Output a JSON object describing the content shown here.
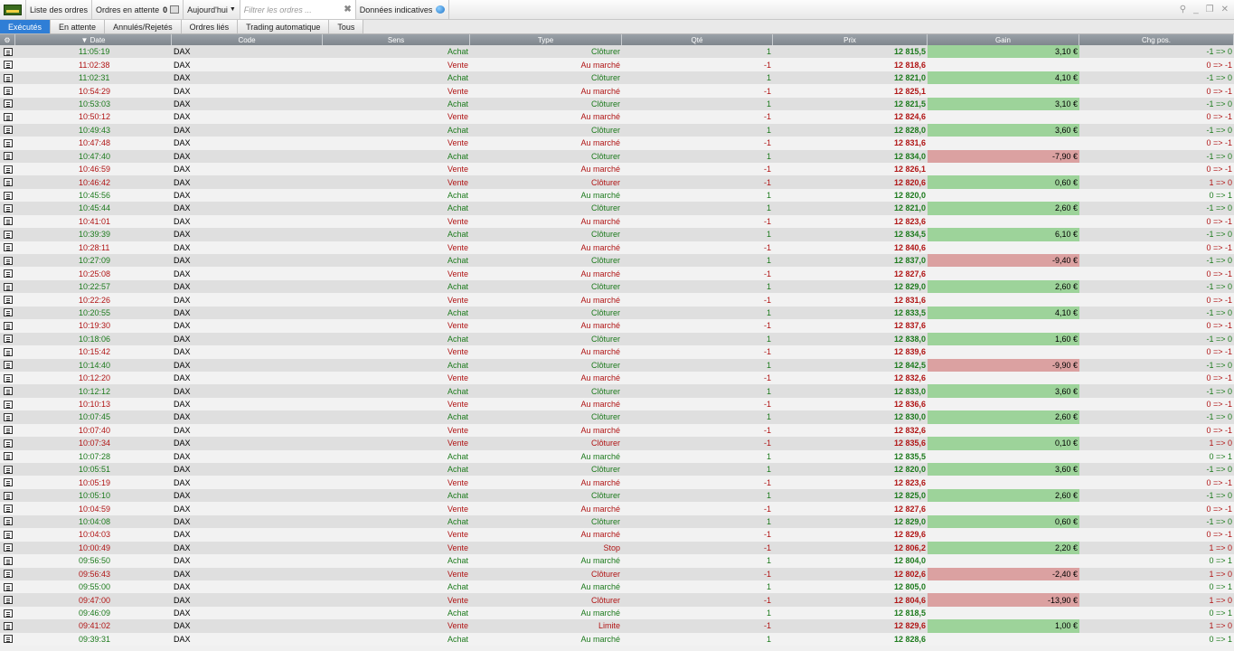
{
  "toolbar": {
    "orders_list": "Liste des ordres",
    "pending_label": "Ordres en attente",
    "pending_count": "0",
    "date_filter": "Aujourd'hui",
    "filter_placeholder": "Filtrer les ordres ...",
    "indicative": "Données indicatives"
  },
  "tabs": [
    "Exécutés",
    "En attente",
    "Annulés/Rejetés",
    "Ordres liés",
    "Trading automatique",
    "Tous"
  ],
  "columns": [
    "Date",
    "Code",
    "Sens",
    "Type",
    "Qté",
    "Prix",
    "Gain",
    "Chg pos."
  ],
  "colors": {
    "buy": "#1c7a1c",
    "sell": "#b01414",
    "gain_positive_bg": "#9dd39a",
    "gain_negative_bg": "#dba1a1",
    "active_tab": "#2f7ed6"
  },
  "rows": [
    {
      "date": "11:05:19",
      "code": "DAX",
      "sens": "Achat",
      "type": "Clôturer",
      "qty": "1",
      "price": "12 815,5",
      "gain": "3,10 €",
      "gain_sign": "pos",
      "chg": "-1 => 0"
    },
    {
      "date": "11:02:38",
      "code": "DAX",
      "sens": "Vente",
      "type": "Au marché",
      "qty": "-1",
      "price": "12 818,6",
      "gain": "",
      "gain_sign": "",
      "chg": "0 => -1"
    },
    {
      "date": "11:02:31",
      "code": "DAX",
      "sens": "Achat",
      "type": "Clôturer",
      "qty": "1",
      "price": "12 821,0",
      "gain": "4,10 €",
      "gain_sign": "pos",
      "chg": "-1 => 0"
    },
    {
      "date": "10:54:29",
      "code": "DAX",
      "sens": "Vente",
      "type": "Au marché",
      "qty": "-1",
      "price": "12 825,1",
      "gain": "",
      "gain_sign": "",
      "chg": "0 => -1"
    },
    {
      "date": "10:53:03",
      "code": "DAX",
      "sens": "Achat",
      "type": "Clôturer",
      "qty": "1",
      "price": "12 821,5",
      "gain": "3,10 €",
      "gain_sign": "pos",
      "chg": "-1 => 0"
    },
    {
      "date": "10:50:12",
      "code": "DAX",
      "sens": "Vente",
      "type": "Au marché",
      "qty": "-1",
      "price": "12 824,6",
      "gain": "",
      "gain_sign": "",
      "chg": "0 => -1"
    },
    {
      "date": "10:49:43",
      "code": "DAX",
      "sens": "Achat",
      "type": "Clôturer",
      "qty": "1",
      "price": "12 828,0",
      "gain": "3,60 €",
      "gain_sign": "pos",
      "chg": "-1 => 0"
    },
    {
      "date": "10:47:48",
      "code": "DAX",
      "sens": "Vente",
      "type": "Au marché",
      "qty": "-1",
      "price": "12 831,6",
      "gain": "",
      "gain_sign": "",
      "chg": "0 => -1"
    },
    {
      "date": "10:47:40",
      "code": "DAX",
      "sens": "Achat",
      "type": "Clôturer",
      "qty": "1",
      "price": "12 834,0",
      "gain": "-7,90 €",
      "gain_sign": "neg",
      "chg": "-1 => 0"
    },
    {
      "date": "10:46:59",
      "code": "DAX",
      "sens": "Vente",
      "type": "Au marché",
      "qty": "-1",
      "price": "12 826,1",
      "gain": "",
      "gain_sign": "",
      "chg": "0 => -1"
    },
    {
      "date": "10:46:42",
      "code": "DAX",
      "sens": "Vente",
      "type": "Clôturer",
      "qty": "-1",
      "price": "12 820,6",
      "gain": "0,60 €",
      "gain_sign": "pos",
      "chg": "1 => 0"
    },
    {
      "date": "10:45:56",
      "code": "DAX",
      "sens": "Achat",
      "type": "Au marché",
      "qty": "1",
      "price": "12 820,0",
      "gain": "",
      "gain_sign": "",
      "chg": "0 => 1"
    },
    {
      "date": "10:45:44",
      "code": "DAX",
      "sens": "Achat",
      "type": "Clôturer",
      "qty": "1",
      "price": "12 821,0",
      "gain": "2,60 €",
      "gain_sign": "pos",
      "chg": "-1 => 0"
    },
    {
      "date": "10:41:01",
      "code": "DAX",
      "sens": "Vente",
      "type": "Au marché",
      "qty": "-1",
      "price": "12 823,6",
      "gain": "",
      "gain_sign": "",
      "chg": "0 => -1"
    },
    {
      "date": "10:39:39",
      "code": "DAX",
      "sens": "Achat",
      "type": "Clôturer",
      "qty": "1",
      "price": "12 834,5",
      "gain": "6,10 €",
      "gain_sign": "pos",
      "chg": "-1 => 0"
    },
    {
      "date": "10:28:11",
      "code": "DAX",
      "sens": "Vente",
      "type": "Au marché",
      "qty": "-1",
      "price": "12 840,6",
      "gain": "",
      "gain_sign": "",
      "chg": "0 => -1"
    },
    {
      "date": "10:27:09",
      "code": "DAX",
      "sens": "Achat",
      "type": "Clôturer",
      "qty": "1",
      "price": "12 837,0",
      "gain": "-9,40 €",
      "gain_sign": "neg",
      "chg": "-1 => 0"
    },
    {
      "date": "10:25:08",
      "code": "DAX",
      "sens": "Vente",
      "type": "Au marché",
      "qty": "-1",
      "price": "12 827,6",
      "gain": "",
      "gain_sign": "",
      "chg": "0 => -1"
    },
    {
      "date": "10:22:57",
      "code": "DAX",
      "sens": "Achat",
      "type": "Clôturer",
      "qty": "1",
      "price": "12 829,0",
      "gain": "2,60 €",
      "gain_sign": "pos",
      "chg": "-1 => 0"
    },
    {
      "date": "10:22:26",
      "code": "DAX",
      "sens": "Vente",
      "type": "Au marché",
      "qty": "-1",
      "price": "12 831,6",
      "gain": "",
      "gain_sign": "",
      "chg": "0 => -1"
    },
    {
      "date": "10:20:55",
      "code": "DAX",
      "sens": "Achat",
      "type": "Clôturer",
      "qty": "1",
      "price": "12 833,5",
      "gain": "4,10 €",
      "gain_sign": "pos",
      "chg": "-1 => 0"
    },
    {
      "date": "10:19:30",
      "code": "DAX",
      "sens": "Vente",
      "type": "Au marché",
      "qty": "-1",
      "price": "12 837,6",
      "gain": "",
      "gain_sign": "",
      "chg": "0 => -1"
    },
    {
      "date": "10:18:06",
      "code": "DAX",
      "sens": "Achat",
      "type": "Clôturer",
      "qty": "1",
      "price": "12 838,0",
      "gain": "1,60 €",
      "gain_sign": "pos",
      "chg": "-1 => 0"
    },
    {
      "date": "10:15:42",
      "code": "DAX",
      "sens": "Vente",
      "type": "Au marché",
      "qty": "-1",
      "price": "12 839,6",
      "gain": "",
      "gain_sign": "",
      "chg": "0 => -1"
    },
    {
      "date": "10:14:40",
      "code": "DAX",
      "sens": "Achat",
      "type": "Clôturer",
      "qty": "1",
      "price": "12 842,5",
      "gain": "-9,90 €",
      "gain_sign": "neg",
      "chg": "-1 => 0"
    },
    {
      "date": "10:12:20",
      "code": "DAX",
      "sens": "Vente",
      "type": "Au marché",
      "qty": "-1",
      "price": "12 832,6",
      "gain": "",
      "gain_sign": "",
      "chg": "0 => -1"
    },
    {
      "date": "10:12:12",
      "code": "DAX",
      "sens": "Achat",
      "type": "Clôturer",
      "qty": "1",
      "price": "12 833,0",
      "gain": "3,60 €",
      "gain_sign": "pos",
      "chg": "-1 => 0"
    },
    {
      "date": "10:10:13",
      "code": "DAX",
      "sens": "Vente",
      "type": "Au marché",
      "qty": "-1",
      "price": "12 836,6",
      "gain": "",
      "gain_sign": "",
      "chg": "0 => -1"
    },
    {
      "date": "10:07:45",
      "code": "DAX",
      "sens": "Achat",
      "type": "Clôturer",
      "qty": "1",
      "price": "12 830,0",
      "gain": "2,60 €",
      "gain_sign": "pos",
      "chg": "-1 => 0"
    },
    {
      "date": "10:07:40",
      "code": "DAX",
      "sens": "Vente",
      "type": "Au marché",
      "qty": "-1",
      "price": "12 832,6",
      "gain": "",
      "gain_sign": "",
      "chg": "0 => -1"
    },
    {
      "date": "10:07:34",
      "code": "DAX",
      "sens": "Vente",
      "type": "Clôturer",
      "qty": "-1",
      "price": "12 835,6",
      "gain": "0,10 €",
      "gain_sign": "pos",
      "chg": "1 => 0"
    },
    {
      "date": "10:07:28",
      "code": "DAX",
      "sens": "Achat",
      "type": "Au marché",
      "qty": "1",
      "price": "12 835,5",
      "gain": "",
      "gain_sign": "",
      "chg": "0 => 1"
    },
    {
      "date": "10:05:51",
      "code": "DAX",
      "sens": "Achat",
      "type": "Clôturer",
      "qty": "1",
      "price": "12 820,0",
      "gain": "3,60 €",
      "gain_sign": "pos",
      "chg": "-1 => 0"
    },
    {
      "date": "10:05:19",
      "code": "DAX",
      "sens": "Vente",
      "type": "Au marché",
      "qty": "-1",
      "price": "12 823,6",
      "gain": "",
      "gain_sign": "",
      "chg": "0 => -1"
    },
    {
      "date": "10:05:10",
      "code": "DAX",
      "sens": "Achat",
      "type": "Clôturer",
      "qty": "1",
      "price": "12 825,0",
      "gain": "2,60 €",
      "gain_sign": "pos",
      "chg": "-1 => 0"
    },
    {
      "date": "10:04:59",
      "code": "DAX",
      "sens": "Vente",
      "type": "Au marché",
      "qty": "-1",
      "price": "12 827,6",
      "gain": "",
      "gain_sign": "",
      "chg": "0 => -1"
    },
    {
      "date": "10:04:08",
      "code": "DAX",
      "sens": "Achat",
      "type": "Clôturer",
      "qty": "1",
      "price": "12 829,0",
      "gain": "0,60 €",
      "gain_sign": "pos",
      "chg": "-1 => 0"
    },
    {
      "date": "10:04:03",
      "code": "DAX",
      "sens": "Vente",
      "type": "Au marché",
      "qty": "-1",
      "price": "12 829,6",
      "gain": "",
      "gain_sign": "",
      "chg": "0 => -1"
    },
    {
      "date": "10:00:49",
      "code": "DAX",
      "sens": "Vente",
      "type": "Stop",
      "qty": "-1",
      "price": "12 806,2",
      "gain": "2,20 €",
      "gain_sign": "pos",
      "chg": "1 => 0"
    },
    {
      "date": "09:56:50",
      "code": "DAX",
      "sens": "Achat",
      "type": "Au marché",
      "qty": "1",
      "price": "12 804,0",
      "gain": "",
      "gain_sign": "",
      "chg": "0 => 1"
    },
    {
      "date": "09:56:43",
      "code": "DAX",
      "sens": "Vente",
      "type": "Clôturer",
      "qty": "-1",
      "price": "12 802,6",
      "gain": "-2,40 €",
      "gain_sign": "neg",
      "chg": "1 => 0"
    },
    {
      "date": "09:55:00",
      "code": "DAX",
      "sens": "Achat",
      "type": "Au marché",
      "qty": "1",
      "price": "12 805,0",
      "gain": "",
      "gain_sign": "",
      "chg": "0 => 1"
    },
    {
      "date": "09:47:00",
      "code": "DAX",
      "sens": "Vente",
      "type": "Clôturer",
      "qty": "-1",
      "price": "12 804,6",
      "gain": "-13,90 €",
      "gain_sign": "neg",
      "chg": "1 => 0"
    },
    {
      "date": "09:46:09",
      "code": "DAX",
      "sens": "Achat",
      "type": "Au marché",
      "qty": "1",
      "price": "12 818,5",
      "gain": "",
      "gain_sign": "",
      "chg": "0 => 1"
    },
    {
      "date": "09:41:02",
      "code": "DAX",
      "sens": "Vente",
      "type": "Limite",
      "qty": "-1",
      "price": "12 829,6",
      "gain": "1,00 €",
      "gain_sign": "pos",
      "chg": "1 => 0"
    },
    {
      "date": "09:39:31",
      "code": "DAX",
      "sens": "Achat",
      "type": "Au marché",
      "qty": "1",
      "price": "12 828,6",
      "gain": "",
      "gain_sign": "",
      "chg": "0 => 1"
    }
  ]
}
